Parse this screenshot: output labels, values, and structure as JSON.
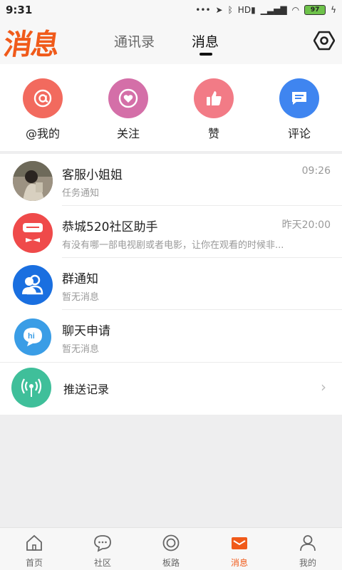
{
  "status": {
    "time": "9:31",
    "battery": "97",
    "sys_text": "HD"
  },
  "header": {
    "logo": "消息",
    "tabs": [
      {
        "label": "通讯录",
        "active": false
      },
      {
        "label": "消息",
        "active": true
      }
    ]
  },
  "quick_actions": [
    {
      "label": "@我的",
      "icon": "at-icon",
      "color": "#f26a5e"
    },
    {
      "label": "关注",
      "icon": "heart-icon",
      "color": "#d46fa8"
    },
    {
      "label": "赞",
      "icon": "thumbs-up-icon",
      "color": "#f27b86"
    },
    {
      "label": "评论",
      "icon": "comment-icon",
      "color": "#3f85f0"
    }
  ],
  "messages": [
    {
      "title": "客服小姐姐",
      "sub": "任务通知",
      "time": "09:26",
      "avatar": "photo-avatar"
    },
    {
      "title": "恭城520社区助手",
      "sub": "有没有哪一部电视剧或者电影，让你在观看的时候非...",
      "time": "昨天20:00",
      "avatar": "assistant-avatar",
      "color": "#ef4a4a"
    },
    {
      "title": "群通知",
      "sub": "暂无消息",
      "time": "",
      "avatar": "group-icon",
      "color": "#1a6fe0"
    },
    {
      "title": "聊天申请",
      "sub": "暂无消息",
      "time": "",
      "avatar": "chat-request-icon",
      "color": "#3a9de6"
    },
    {
      "title": "推送记录",
      "sub": "",
      "time": "",
      "avatar": "broadcast-icon",
      "color": "#3fbf9a"
    }
  ],
  "bottom_nav": [
    {
      "label": "首页",
      "icon": "home-icon",
      "active": false
    },
    {
      "label": "社区",
      "icon": "community-icon",
      "active": false
    },
    {
      "label": "板路",
      "icon": "circle-icon",
      "active": false
    },
    {
      "label": "消息",
      "icon": "mail-icon",
      "active": true
    },
    {
      "label": "我的",
      "icon": "person-icon",
      "active": false
    }
  ],
  "colors": {
    "accent": "#f05a1a"
  }
}
